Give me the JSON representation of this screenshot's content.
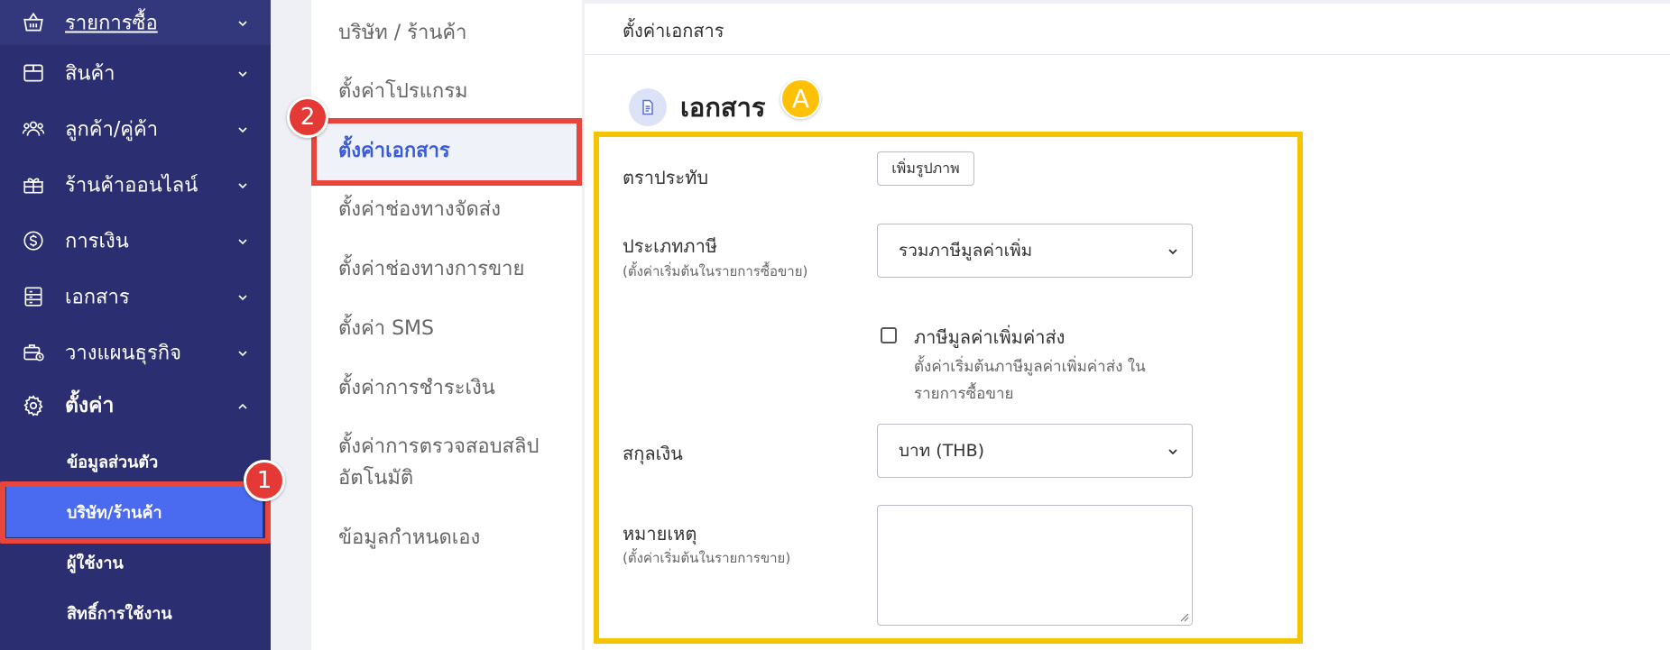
{
  "sidebar": {
    "items": [
      {
        "label": "รายการซื้อ",
        "icon": "basket-icon"
      },
      {
        "label": "สินค้า",
        "icon": "box-icon"
      },
      {
        "label": "ลูกค้า/คู่ค้า",
        "icon": "users-icon"
      },
      {
        "label": "ร้านค้าออนไลน์",
        "icon": "gift-icon"
      },
      {
        "label": "การเงิน",
        "icon": "dollar-circle-icon"
      },
      {
        "label": "เอกสาร",
        "icon": "document-icon"
      },
      {
        "label": "วางแผนธุรกิจ",
        "icon": "briefcase-icon"
      },
      {
        "label": "ตั้งค่า",
        "icon": "gear-icon"
      }
    ],
    "settings_sub": [
      {
        "label": "ข้อมูลส่วนตัว"
      },
      {
        "label": "บริษัท/ร้านค้า"
      },
      {
        "label": "ผู้ใช้งาน"
      },
      {
        "label": "สิทธิ์การใช้งาน"
      }
    ]
  },
  "badges": {
    "one": "1",
    "two": "2",
    "a": "A"
  },
  "settings_menu": {
    "items": [
      {
        "label": "บริษัท / ร้านค้า"
      },
      {
        "label": "ตั้งค่าโปรแกรม"
      },
      {
        "label": "ตั้งค่าเอกสาร"
      },
      {
        "label": "ตั้งค่าช่องทางจัดส่ง"
      },
      {
        "label": "ตั้งค่าช่องทางการขาย"
      },
      {
        "label": "ตั้งค่า SMS"
      },
      {
        "label": "ตั้งค่าการชำระเงิน"
      },
      {
        "label": "ตั้งค่าการตรวจสอบสลิป"
      },
      {
        "label": "อัตโนมัติ"
      },
      {
        "label": "ข้อมูลกำหนดเอง"
      }
    ]
  },
  "main": {
    "breadcrumb": "ตั้งค่าเอกสาร",
    "title": "เอกสาร",
    "form": {
      "stamp_label": "ตราประทับ",
      "add_image_button": "เพิ่มรูปภาพ",
      "tax_type_label": "ประเภทภาษี",
      "tax_type_hint": "(ตั้งค่าเริ่มต้นในรายการซื้อขาย)",
      "tax_type_value": "รวมภาษีมูลค่าเพิ่ม",
      "shipping_vat_label": "ภาษีมูลค่าเพิ่มค่าส่ง",
      "shipping_vat_hint_line1": "ตั้งค่าเริ่มต้นภาษีมูลค่าเพิ่มค่าส่ง ใน",
      "shipping_vat_hint_line2": "รายการซื้อขาย",
      "shipping_vat_checked": false,
      "currency_label": "สกุลเงิน",
      "currency_value": "บาท (THB)",
      "remark_label": "หมายเหตุ",
      "remark_hint": "(ตั้งค่าเริ่มต้นในรายการขาย)",
      "remark_value": ""
    }
  },
  "colors": {
    "sidebar_bg": "#2b2f72",
    "active_sub_bg": "#4a6af0",
    "annotation_red": "#e8453c",
    "annotation_yellow": "#f5c400",
    "accent_blue": "#3a5bd9"
  }
}
